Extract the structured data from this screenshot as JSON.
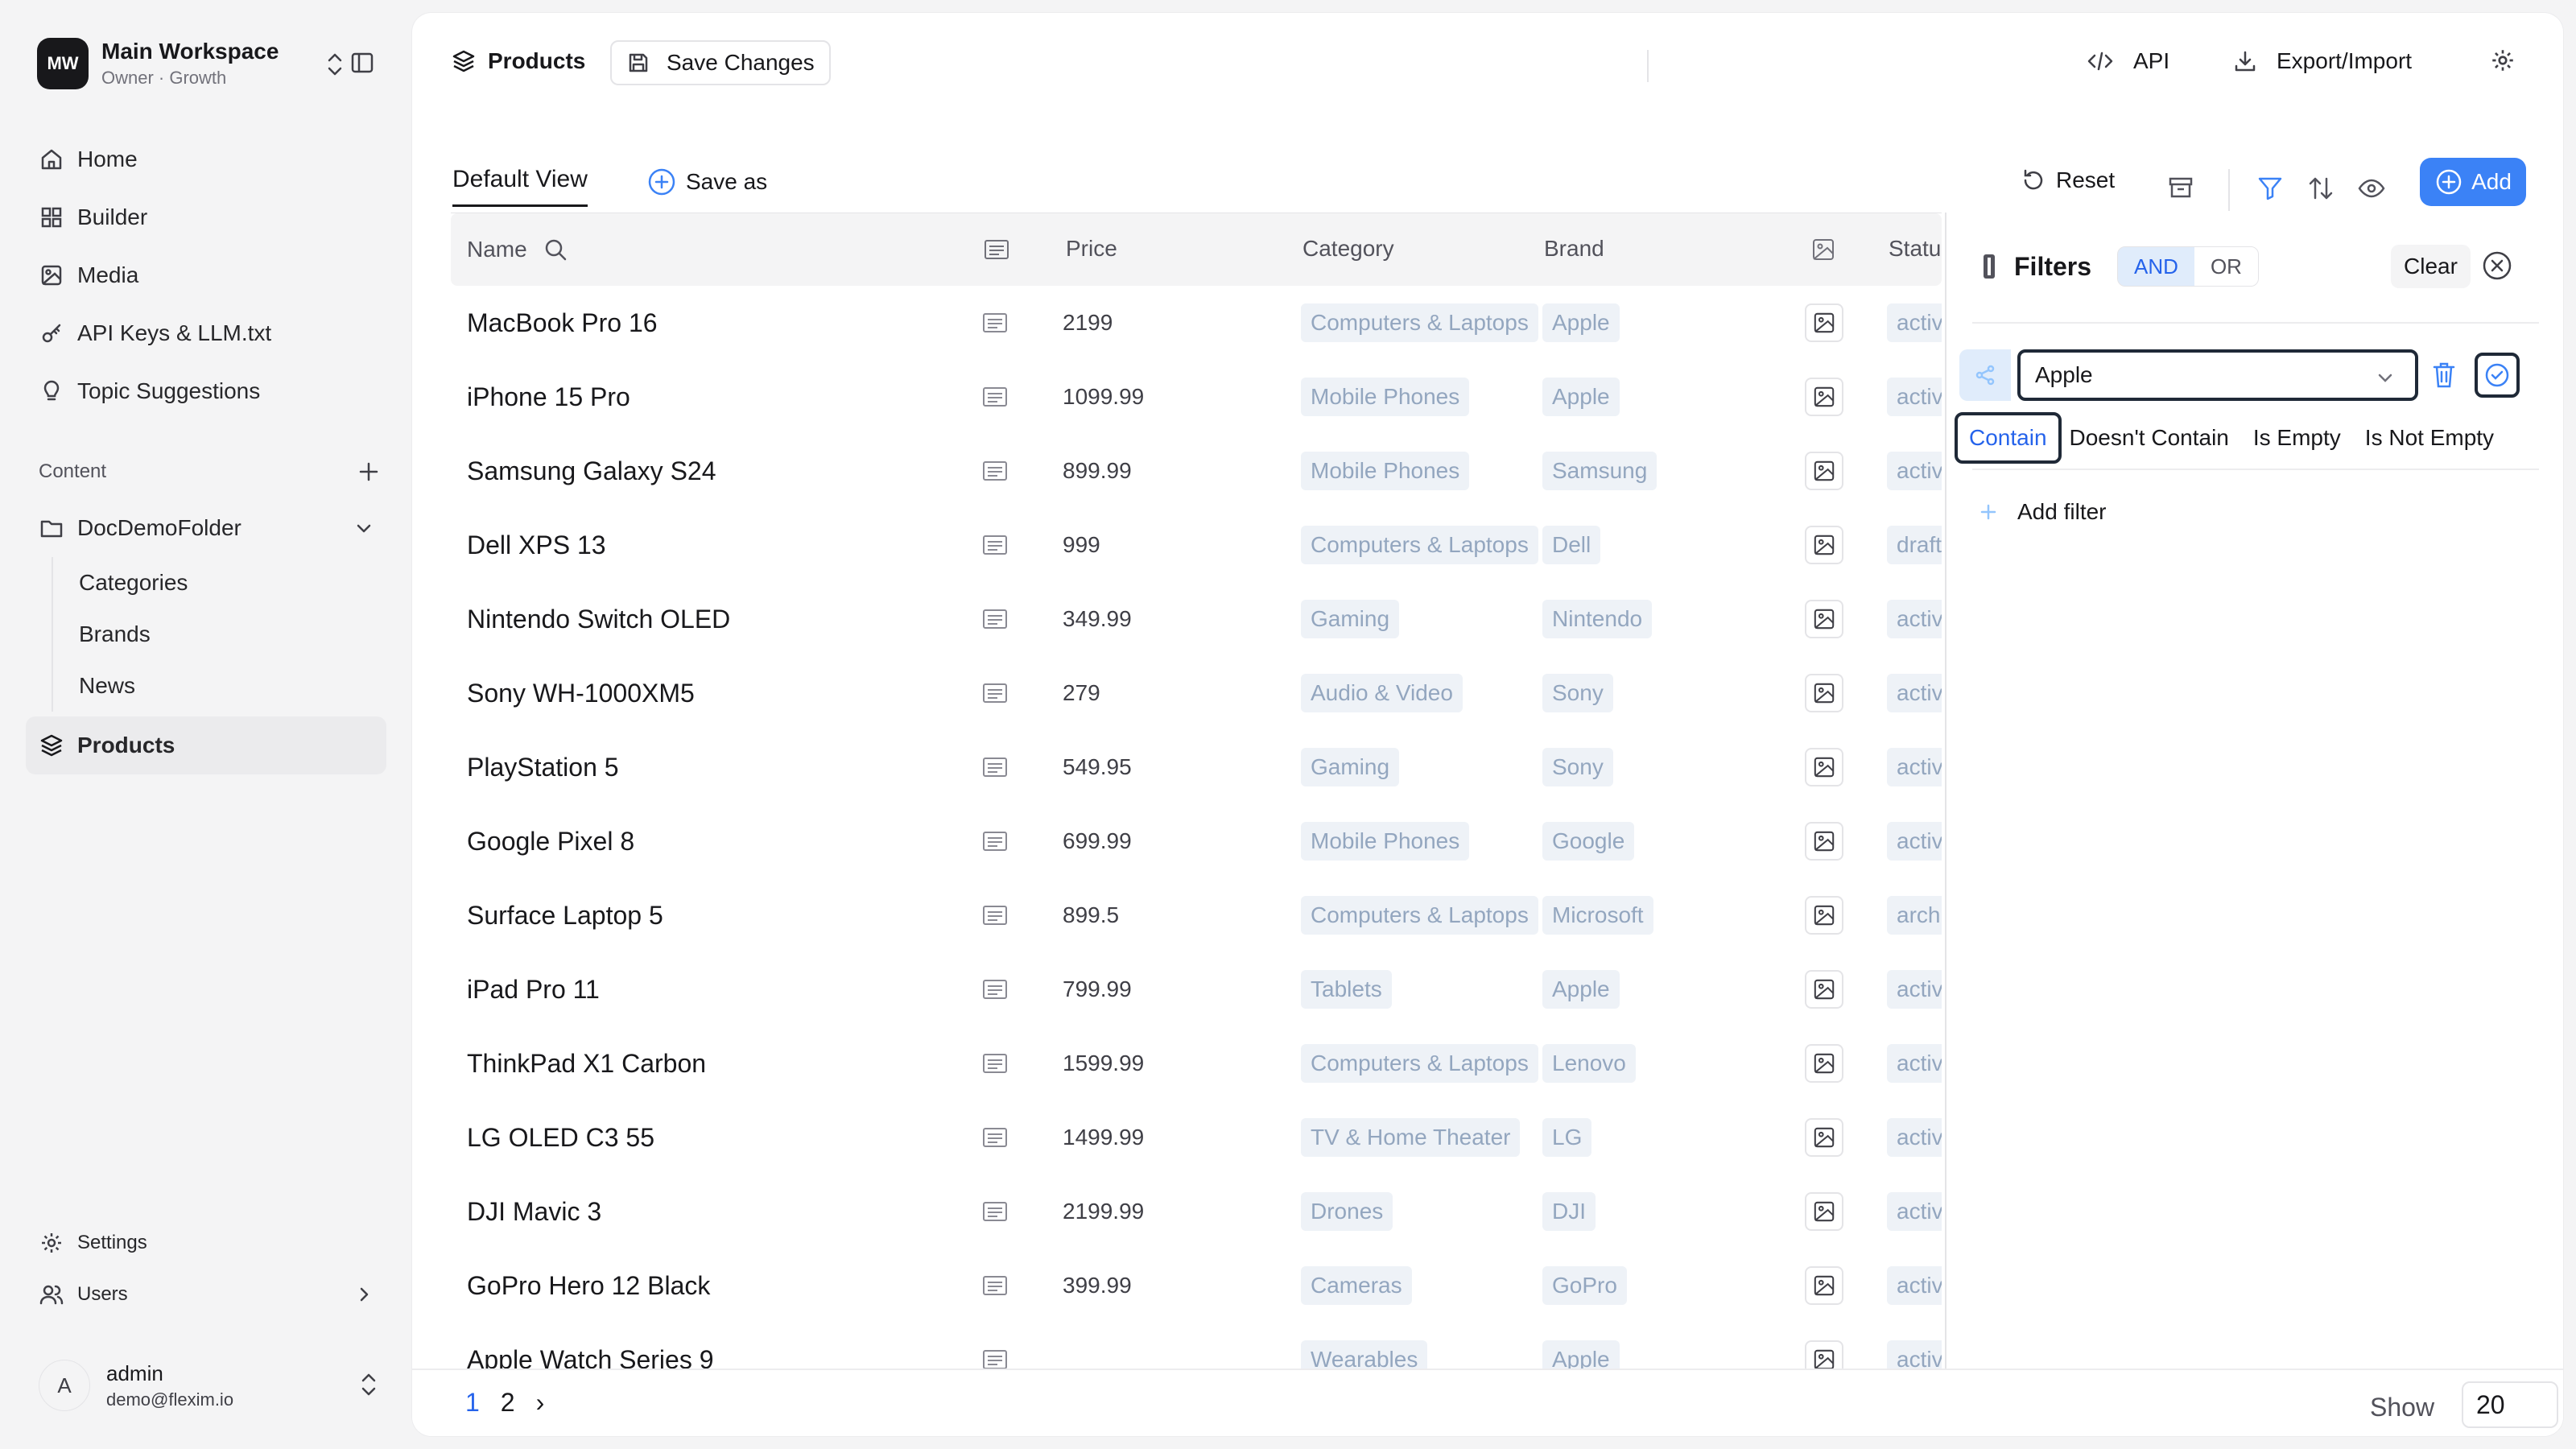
{
  "workspace": {
    "initials": "MW",
    "name": "Main Workspace",
    "subtitle": "Owner · Growth"
  },
  "sidebar": {
    "items": [
      {
        "label": "Home",
        "icon": "home-icon"
      },
      {
        "label": "Builder",
        "icon": "grid-icon"
      },
      {
        "label": "Media",
        "icon": "image-icon"
      },
      {
        "label": "API Keys & LLM.txt",
        "icon": "key-icon"
      },
      {
        "label": "Topic Suggestions",
        "icon": "lightbulb-icon"
      }
    ],
    "content_label": "Content",
    "folder": {
      "label": "DocDemoFolder",
      "children": [
        "Categories",
        "Brands",
        "News"
      ]
    },
    "products_label": "Products",
    "settings_label": "Settings",
    "users_label": "Users"
  },
  "user": {
    "initial": "A",
    "name": "admin",
    "email": "demo@flexim.io"
  },
  "topbar": {
    "title": "Products",
    "save_label": "Save Changes",
    "api_label": "API",
    "export_label": "Export/Import"
  },
  "viewbar": {
    "view_label": "Default View",
    "save_as_label": "Save as",
    "reset_label": "Reset",
    "add_label": "Add"
  },
  "table": {
    "headers": {
      "name": "Name",
      "price": "Price",
      "category": "Category",
      "brand": "Brand",
      "status": "Status"
    },
    "rows": [
      {
        "name": "MacBook Pro 16",
        "price": "2199",
        "category": "Computers & Laptops",
        "brand": "Apple",
        "status": "active"
      },
      {
        "name": "iPhone 15 Pro",
        "price": "1099.99",
        "category": "Mobile Phones",
        "brand": "Apple",
        "status": "active"
      },
      {
        "name": "Samsung Galaxy S24",
        "price": "899.99",
        "category": "Mobile Phones",
        "brand": "Samsung",
        "status": "active"
      },
      {
        "name": "Dell XPS 13",
        "price": "999",
        "category": "Computers & Laptops",
        "brand": "Dell",
        "status": "draft"
      },
      {
        "name": "Nintendo Switch OLED",
        "price": "349.99",
        "category": "Gaming",
        "brand": "Nintendo",
        "status": "active"
      },
      {
        "name": "Sony WH-1000XM5",
        "price": "279",
        "category": "Audio & Video",
        "brand": "Sony",
        "status": "active"
      },
      {
        "name": "PlayStation 5",
        "price": "549.95",
        "category": "Gaming",
        "brand": "Sony",
        "status": "active"
      },
      {
        "name": "Google Pixel 8",
        "price": "699.99",
        "category": "Mobile Phones",
        "brand": "Google",
        "status": "active"
      },
      {
        "name": "Surface Laptop 5",
        "price": "899.5",
        "category": "Computers & Laptops",
        "brand": "Microsoft",
        "status": "archived"
      },
      {
        "name": "iPad Pro 11",
        "price": "799.99",
        "category": "Tablets",
        "brand": "Apple",
        "status": "active"
      },
      {
        "name": "ThinkPad X1 Carbon",
        "price": "1599.99",
        "category": "Computers & Laptops",
        "brand": "Lenovo",
        "status": "active"
      },
      {
        "name": "LG OLED C3 55",
        "price": "1499.99",
        "category": "TV & Home Theater",
        "brand": "LG",
        "status": "active"
      },
      {
        "name": "DJI Mavic 3",
        "price": "2199.99",
        "category": "Drones",
        "brand": "DJI",
        "status": "active"
      },
      {
        "name": "GoPro Hero 12 Black",
        "price": "399.99",
        "category": "Cameras",
        "brand": "GoPro",
        "status": "active"
      },
      {
        "name": "Apple Watch Series 9",
        "price": "",
        "category": "Wearables",
        "brand": "Apple",
        "status": "active"
      }
    ]
  },
  "filters": {
    "title": "Filters",
    "and_label": "AND",
    "or_label": "OR",
    "clear_label": "Clear",
    "value": "Apple",
    "operators": [
      "Contain",
      "Doesn't Contain",
      "Is Empty",
      "Is Not Empty"
    ],
    "selected_operator": "Contain",
    "add_filter_label": "Add filter"
  },
  "pagination": {
    "pages": [
      "1",
      "2"
    ],
    "current": "1",
    "next_label": "›",
    "show_label": "Show",
    "per_page": "20"
  },
  "colors": {
    "accent": "#3b82f6",
    "chip_bg": "#eef2f7",
    "chip_text": "#93a6bf"
  }
}
